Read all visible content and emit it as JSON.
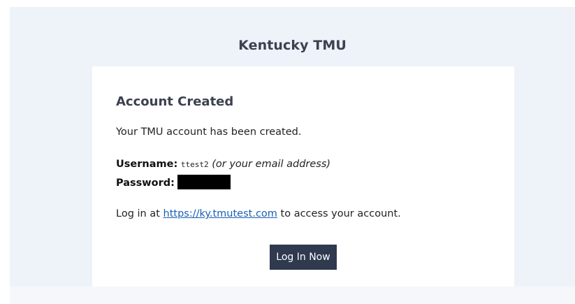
{
  "header": {
    "brand_title": "Kentucky TMU"
  },
  "card": {
    "heading": "Account Created",
    "intro": "Your TMU account has been created.",
    "username_label": "Username:",
    "username_value": "ttest2",
    "username_note": "(or your email address)",
    "password_label": "Password:",
    "login_prefix": "Log in at ",
    "login_link": "https://ky.tmutest.com",
    "login_suffix": " to access your account.",
    "button_label": "Log In Now"
  },
  "colors": {
    "page_background": "#eef2f9",
    "card_background": "#ffffff",
    "heading_text": "#3b4150",
    "link": "#1a5fb4",
    "button_background": "#2f3a4f",
    "button_text": "#ffffff",
    "redaction": "#000000"
  }
}
